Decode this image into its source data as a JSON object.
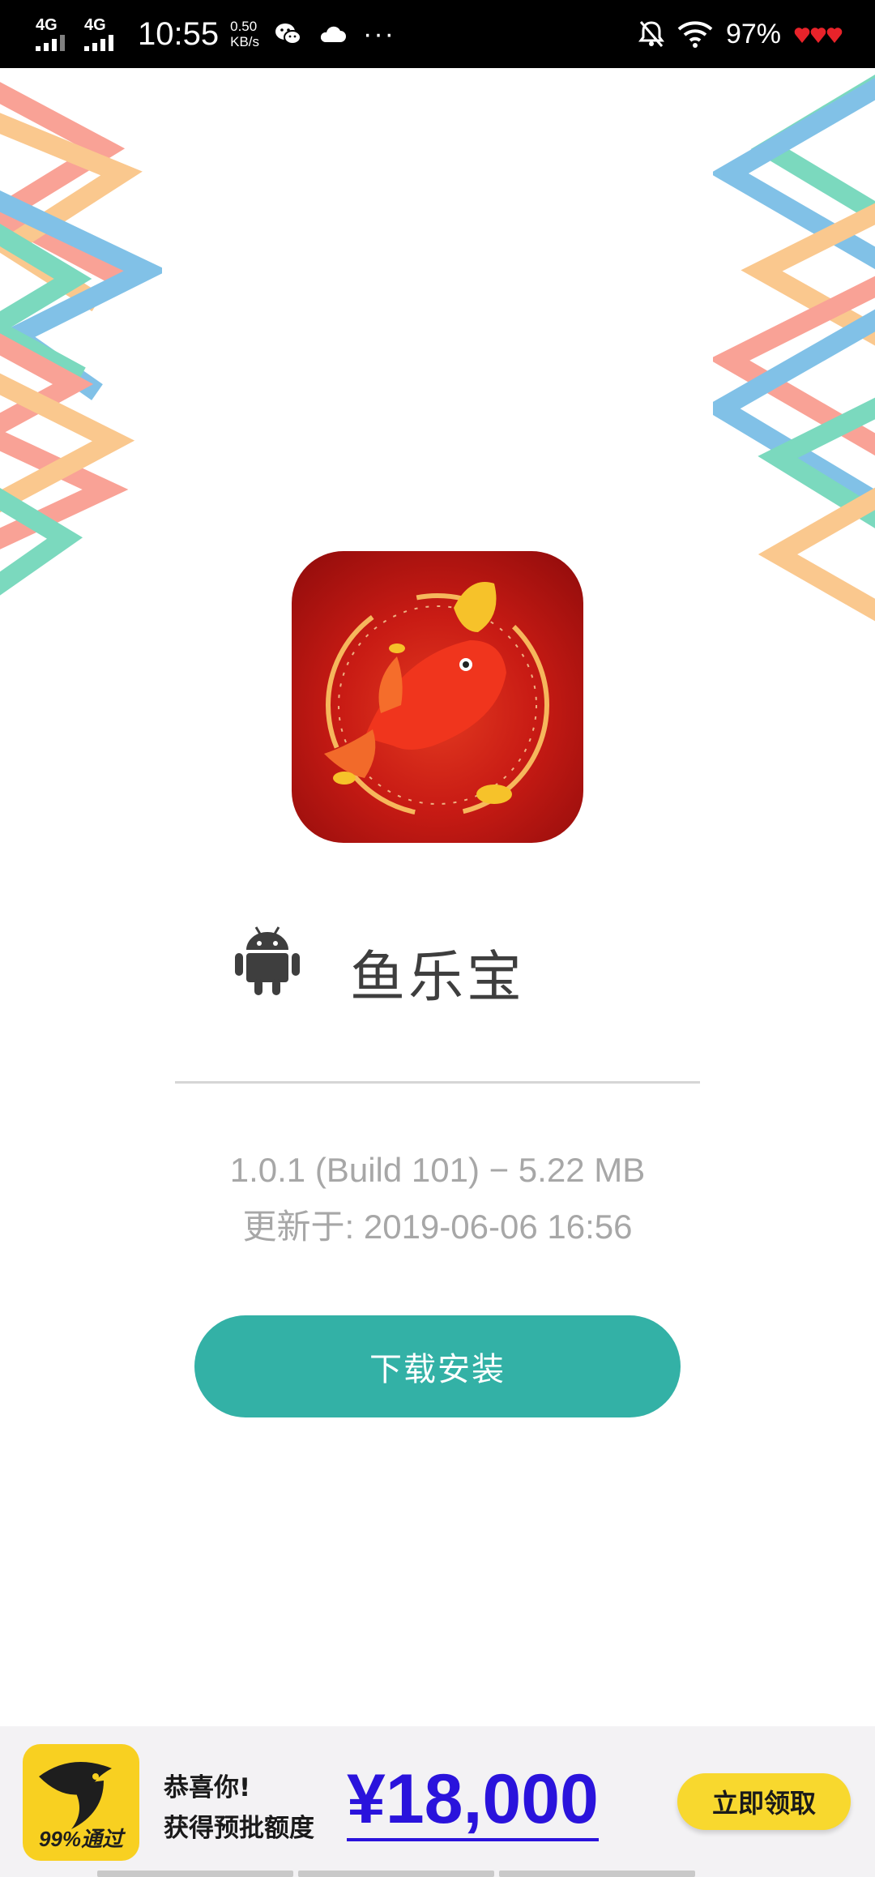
{
  "status_bar": {
    "signal1_label": "4G",
    "signal2_label": "4G",
    "time": "10:55",
    "speed_value": "0.50",
    "speed_unit": "KB/s",
    "more": "···",
    "battery": "97%",
    "icons": [
      "wechat-icon",
      "cloud-icon",
      "mute-bell-icon",
      "wifi-icon",
      "heart-battery-icon"
    ]
  },
  "app": {
    "name": "鱼乐宝",
    "version_line": "1.0.1 (Build 101) − 5.22 MB",
    "updated_line": "更新于: 2019-06-06 16:56",
    "download_label": "下载安装",
    "platform_icon": "android-icon"
  },
  "ad": {
    "logo_text": "99%通过",
    "congrats": "恭喜你!",
    "subtitle": "获得预批额度",
    "amount": "¥18,000",
    "claim_label": "立即领取",
    "accent_color": "#2a13dc",
    "button_color": "#f8d82e"
  },
  "colors": {
    "download_button": "#33b1a6",
    "title_text": "#3e3e3e",
    "meta_text": "#a7a7a7"
  }
}
